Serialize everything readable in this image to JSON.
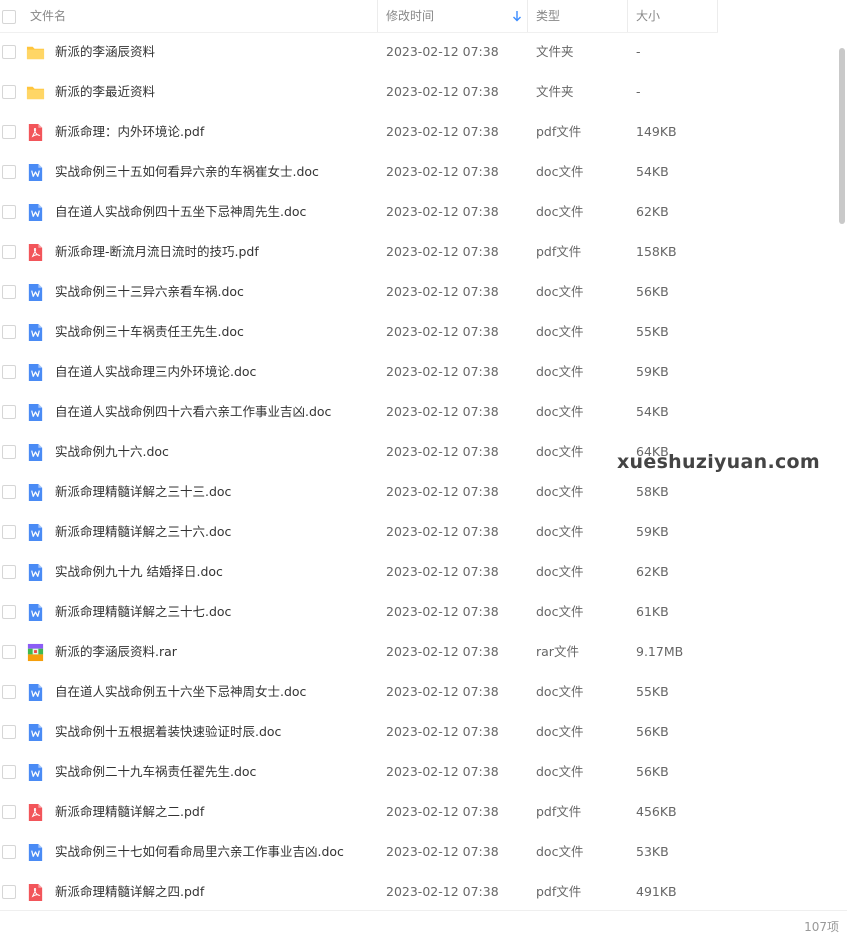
{
  "header": {
    "name_label": "文件名",
    "mtime_label": "修改时间",
    "type_label": "类型",
    "size_label": "大小"
  },
  "files": [
    {
      "name": "新派的李涵辰资料",
      "date": "2023-02-12 07:38",
      "type": "文件夹",
      "size": "-",
      "icon": "folder-icon"
    },
    {
      "name": "新派的李最近资料",
      "date": "2023-02-12 07:38",
      "type": "文件夹",
      "size": "-",
      "icon": "folder-icon"
    },
    {
      "name": "新派命理：内外环境论.pdf",
      "date": "2023-02-12 07:38",
      "type": "pdf文件",
      "size": "149KB",
      "icon": "pdf-icon"
    },
    {
      "name": "实战命例三十五如何看异六亲的车祸崔女士.doc",
      "date": "2023-02-12 07:38",
      "type": "doc文件",
      "size": "54KB",
      "icon": "doc-icon"
    },
    {
      "name": "自在道人实战命例四十五坐下忌神周先生.doc",
      "date": "2023-02-12 07:38",
      "type": "doc文件",
      "size": "62KB",
      "icon": "doc-icon"
    },
    {
      "name": "新派命理-断流月流日流时的技巧.pdf",
      "date": "2023-02-12 07:38",
      "type": "pdf文件",
      "size": "158KB",
      "icon": "pdf-icon"
    },
    {
      "name": "实战命例三十三异六亲看车祸.doc",
      "date": "2023-02-12 07:38",
      "type": "doc文件",
      "size": "56KB",
      "icon": "doc-icon"
    },
    {
      "name": "实战命例三十车祸责任王先生.doc",
      "date": "2023-02-12 07:38",
      "type": "doc文件",
      "size": "55KB",
      "icon": "doc-icon"
    },
    {
      "name": "自在道人实战命理三内外环境论.doc",
      "date": "2023-02-12 07:38",
      "type": "doc文件",
      "size": "59KB",
      "icon": "doc-icon"
    },
    {
      "name": "自在道人实战命例四十六看六亲工作事业吉凶.doc",
      "date": "2023-02-12 07:38",
      "type": "doc文件",
      "size": "54KB",
      "icon": "doc-icon"
    },
    {
      "name": "实战命例九十六.doc",
      "date": "2023-02-12 07:38",
      "type": "doc文件",
      "size": "64KB",
      "icon": "doc-icon"
    },
    {
      "name": "新派命理精髓详解之三十三.doc",
      "date": "2023-02-12 07:38",
      "type": "doc文件",
      "size": "58KB",
      "icon": "doc-icon"
    },
    {
      "name": "新派命理精髓详解之三十六.doc",
      "date": "2023-02-12 07:38",
      "type": "doc文件",
      "size": "59KB",
      "icon": "doc-icon"
    },
    {
      "name": "实战命例九十九 结婚择日.doc",
      "date": "2023-02-12 07:38",
      "type": "doc文件",
      "size": "62KB",
      "icon": "doc-icon"
    },
    {
      "name": "新派命理精髓详解之三十七.doc",
      "date": "2023-02-12 07:38",
      "type": "doc文件",
      "size": "61KB",
      "icon": "doc-icon"
    },
    {
      "name": "新派的李涵辰资料.rar",
      "date": "2023-02-12 07:38",
      "type": "rar文件",
      "size": "9.17MB",
      "icon": "rar-icon"
    },
    {
      "name": "自在道人实战命例五十六坐下忌神周女士.doc",
      "date": "2023-02-12 07:38",
      "type": "doc文件",
      "size": "55KB",
      "icon": "doc-icon"
    },
    {
      "name": "实战命例十五根据着装快速验证时辰.doc",
      "date": "2023-02-12 07:38",
      "type": "doc文件",
      "size": "56KB",
      "icon": "doc-icon"
    },
    {
      "name": "实战命例二十九车祸责任翟先生.doc",
      "date": "2023-02-12 07:38",
      "type": "doc文件",
      "size": "56KB",
      "icon": "doc-icon"
    },
    {
      "name": "新派命理精髓详解之二.pdf",
      "date": "2023-02-12 07:38",
      "type": "pdf文件",
      "size": "456KB",
      "icon": "pdf-icon"
    },
    {
      "name": "实战命例三十七如何看命局里六亲工作事业吉凶.doc",
      "date": "2023-02-12 07:38",
      "type": "doc文件",
      "size": "53KB",
      "icon": "doc-icon"
    },
    {
      "name": "新派命理精髓详解之四.pdf",
      "date": "2023-02-12 07:38",
      "type": "pdf文件",
      "size": "491KB",
      "icon": "pdf-icon"
    }
  ],
  "footer": {
    "count": "107项"
  },
  "watermark": "xueshuziyuan.com",
  "colors": {
    "folder": "#FFC53D",
    "pdf": "#F2555A",
    "doc": "#4A8BF5",
    "accent": "#3B8CFF"
  }
}
